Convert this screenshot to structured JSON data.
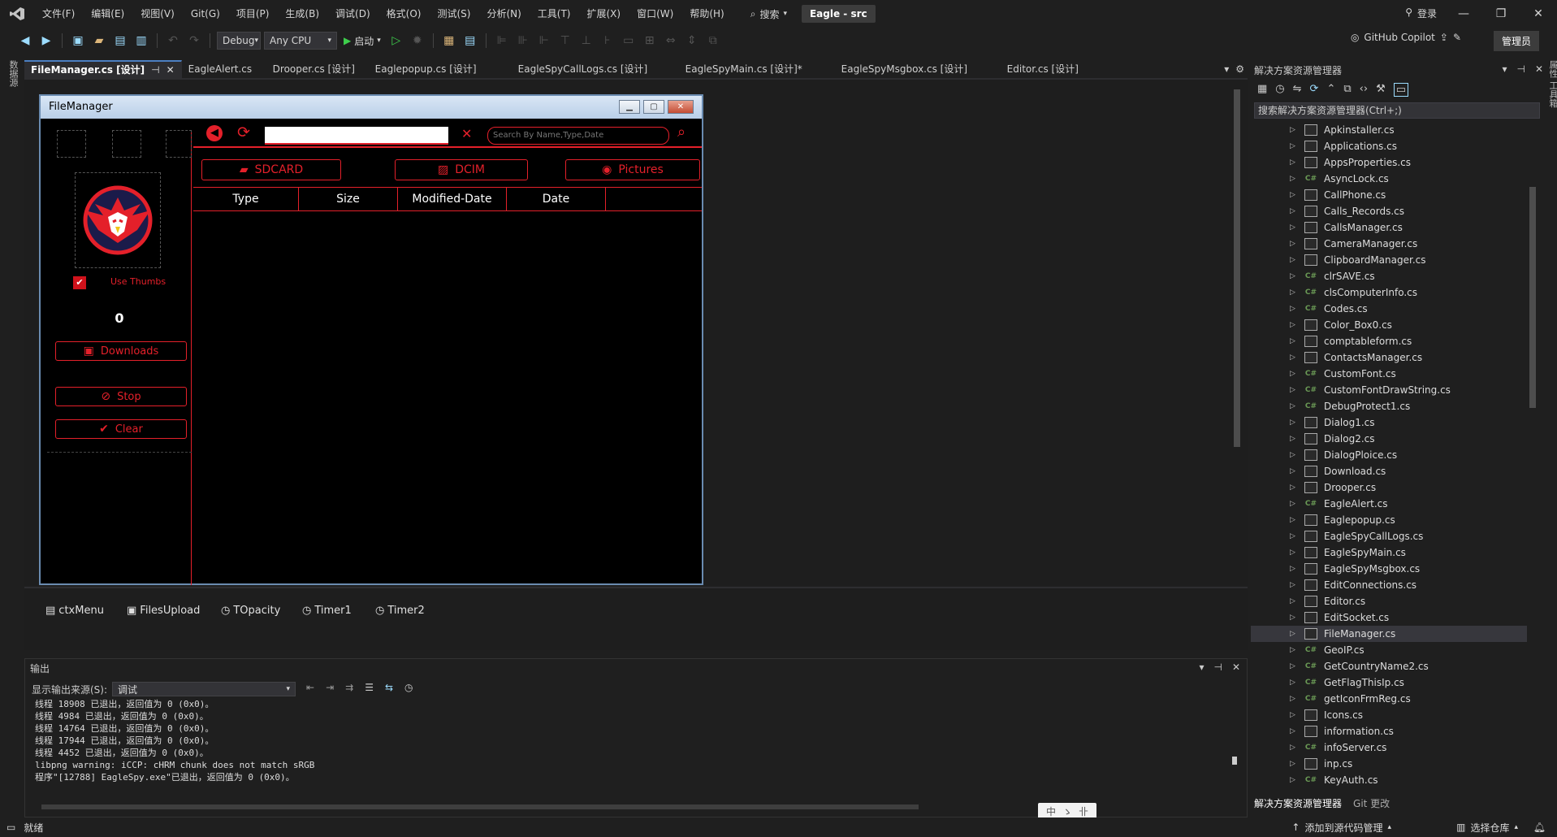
{
  "menu": [
    "文件(F)",
    "编辑(E)",
    "视图(V)",
    "Git(G)",
    "项目(P)",
    "生成(B)",
    "调试(D)",
    "格式(O)",
    "测试(S)",
    "分析(N)",
    "工具(T)",
    "扩展(X)",
    "窗口(W)",
    "帮助(H)"
  ],
  "search_label": "搜索",
  "solution_title": "Eagle - src",
  "login_label": "登录",
  "toolbar": {
    "config": "Debug",
    "platform": "Any CPU",
    "start_label": "启动",
    "copilot_label": "GitHub Copilot",
    "admin_label": "管理员"
  },
  "left_strip_label": "数据源",
  "right_strip_label": "属性 工具箱",
  "tabs": [
    {
      "label": "FileManager.cs [设计]",
      "active": true
    },
    {
      "label": "EagleAlert.cs"
    },
    {
      "label": "Drooper.cs [设计]"
    },
    {
      "label": "Eaglepopup.cs [设计]"
    },
    {
      "label": "EagleSpyCallLogs.cs [设计]"
    },
    {
      "label": "EagleSpyMain.cs [设计]*"
    },
    {
      "label": "EagleSpyMsgbox.cs [设计]"
    },
    {
      "label": "Editor.cs [设计]"
    }
  ],
  "form": {
    "title": "FileManager",
    "use_thumbs": "Use Thumbs",
    "counter": "0",
    "downloads_btn": "Downloads",
    "stop_btn": "Stop",
    "clear_btn": "Clear",
    "search_placeholder": "Search By Name,Type,Date",
    "sdcard_btn": "SDCARD",
    "dcim_btn": "DCIM",
    "pictures_btn": "Pictures",
    "columns": [
      "Type",
      "Size",
      "Modified-Date",
      "Date"
    ],
    "accent_color": "#e4202a"
  },
  "tray": [
    "ctxMenu",
    "FilesUpload",
    "TOpacity",
    "Timer1",
    "Timer2"
  ],
  "output": {
    "title": "输出",
    "source_label": "显示输出来源(S):",
    "source_value": "调试",
    "lines": [
      "线程 18908 已退出，返回值为 0 (0x0)。",
      "线程 4984 已退出，返回值为 0 (0x0)。",
      "线程 14764 已退出，返回值为 0 (0x0)。",
      "线程 17944 已退出，返回值为 0 (0x0)。",
      "线程 4452 已退出，返回值为 0 (0x0)。",
      "libpng warning: iCCP: cHRM chunk does not match sRGB",
      "程序\"[12788] EagleSpy.exe\"已退出，返回值为 0 (0x0)。"
    ]
  },
  "solution_explorer": {
    "title": "解决方案资源管理器",
    "search_placeholder": "搜索解决方案资源管理器(Ctrl+;)",
    "files": [
      {
        "name": "Apkinstaller.cs",
        "icon": "form"
      },
      {
        "name": "Applications.cs",
        "icon": "form"
      },
      {
        "name": "AppsProperties.cs",
        "icon": "form"
      },
      {
        "name": "AsyncLock.cs",
        "icon": "cs"
      },
      {
        "name": "CallPhone.cs",
        "icon": "form"
      },
      {
        "name": "Calls_Records.cs",
        "icon": "form"
      },
      {
        "name": "CallsManager.cs",
        "icon": "form"
      },
      {
        "name": "CameraManager.cs",
        "icon": "form"
      },
      {
        "name": "ClipboardManager.cs",
        "icon": "form"
      },
      {
        "name": "clrSAVE.cs",
        "icon": "cs"
      },
      {
        "name": "clsComputerInfo.cs",
        "icon": "cs"
      },
      {
        "name": "Codes.cs",
        "icon": "cs"
      },
      {
        "name": "Color_Box0.cs",
        "icon": "form"
      },
      {
        "name": "comptableform.cs",
        "icon": "form"
      },
      {
        "name": "ContactsManager.cs",
        "icon": "form"
      },
      {
        "name": "CustomFont.cs",
        "icon": "cs"
      },
      {
        "name": "CustomFontDrawString.cs",
        "icon": "cs"
      },
      {
        "name": "DebugProtect1.cs",
        "icon": "cs"
      },
      {
        "name": "Dialog1.cs",
        "icon": "form"
      },
      {
        "name": "Dialog2.cs",
        "icon": "form"
      },
      {
        "name": "DialogPloice.cs",
        "icon": "form"
      },
      {
        "name": "Download.cs",
        "icon": "form"
      },
      {
        "name": "Drooper.cs",
        "icon": "form"
      },
      {
        "name": "EagleAlert.cs",
        "icon": "cs"
      },
      {
        "name": "Eaglepopup.cs",
        "icon": "form"
      },
      {
        "name": "EagleSpyCallLogs.cs",
        "icon": "form"
      },
      {
        "name": "EagleSpyMain.cs",
        "icon": "form"
      },
      {
        "name": "EagleSpyMsgbox.cs",
        "icon": "form"
      },
      {
        "name": "EditConnections.cs",
        "icon": "form"
      },
      {
        "name": "Editor.cs",
        "icon": "form"
      },
      {
        "name": "EditSocket.cs",
        "icon": "form"
      },
      {
        "name": "FileManager.cs",
        "icon": "form",
        "selected": true
      },
      {
        "name": "GeoIP.cs",
        "icon": "cs"
      },
      {
        "name": "GetCountryName2.cs",
        "icon": "cs"
      },
      {
        "name": "GetFlagThisIp.cs",
        "icon": "cs"
      },
      {
        "name": "getIconFrmReg.cs",
        "icon": "cs"
      },
      {
        "name": "Icons.cs",
        "icon": "form"
      },
      {
        "name": "information.cs",
        "icon": "form"
      },
      {
        "name": "infoServer.cs",
        "icon": "cs"
      },
      {
        "name": "inp.cs",
        "icon": "form"
      },
      {
        "name": "KeyAuth.cs",
        "icon": "cs"
      }
    ],
    "bottom_tabs": [
      "解决方案资源管理器",
      "Git 更改"
    ]
  },
  "status": {
    "ready": "就绪",
    "add_source": "添加到源代码管理",
    "select_repo": "选择仓库"
  },
  "ime": [
    "中",
    "ゝ",
    "卝"
  ]
}
